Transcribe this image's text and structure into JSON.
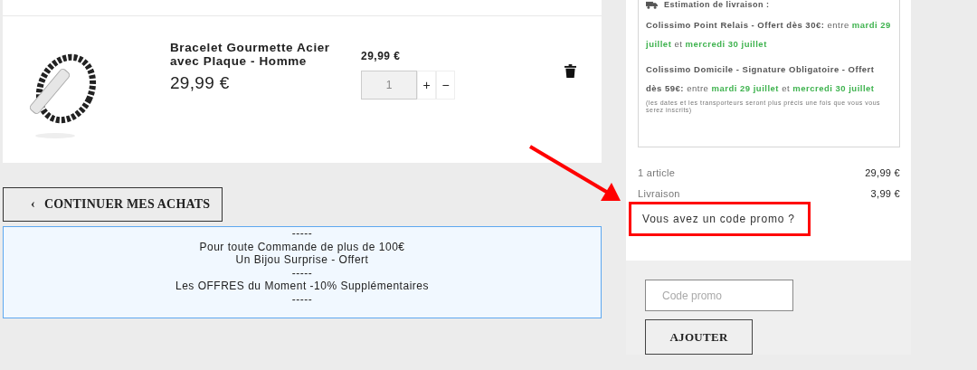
{
  "cart_item": {
    "name": "Bracelet Gourmette Acier avec Plaque - Homme",
    "price": "29,99 €",
    "unit_price": "29,99 €",
    "quantity": "1",
    "increase": "+",
    "decrease": "−"
  },
  "continue_button": {
    "icon": "‹",
    "label": "CONTINUER MES ACHATS"
  },
  "promo_banner": {
    "lines": [
      "-----",
      "Pour toute Commande de plus de 100€",
      "Un Bijou Surprise - Offert",
      "-----",
      "Les OFFRES du Moment -10% Supplémentaires",
      "-----"
    ]
  },
  "delivery": {
    "title": "Estimation de livraison :",
    "options": [
      [
        {
          "kind": "label",
          "text": "Colissimo Point Relais - Offert dès 30€:"
        },
        {
          "kind": "plain",
          "text": "entre"
        },
        {
          "kind": "date",
          "text": "mardi 29 juillet"
        },
        {
          "kind": "plain",
          "text": "et"
        },
        {
          "kind": "date",
          "text": "mercredi 30 juillet"
        }
      ],
      [
        {
          "kind": "label",
          "text": "Colissimo Domicile - Signature Obligatoire - Offert dès 59€:"
        },
        {
          "kind": "plain",
          "text": "entre"
        },
        {
          "kind": "date",
          "text": "mardi 29 juillet"
        },
        {
          "kind": "plain",
          "text": "et"
        },
        {
          "kind": "date",
          "text": "mercredi 30 juillet"
        }
      ]
    ],
    "note": "(les dates et les transporteurs seront plus précis une fois que vous vous serez inscrits)"
  },
  "summary": [
    {
      "label": "1 article",
      "value": "29,99 €"
    },
    {
      "label": "Livraison",
      "value": "3,99 €"
    }
  ],
  "promo_link": {
    "text": "Vous avez un code promo ?",
    "highlighted": true
  },
  "promo_form": {
    "placeholder": "Code promo",
    "button": "AJOUTER"
  }
}
